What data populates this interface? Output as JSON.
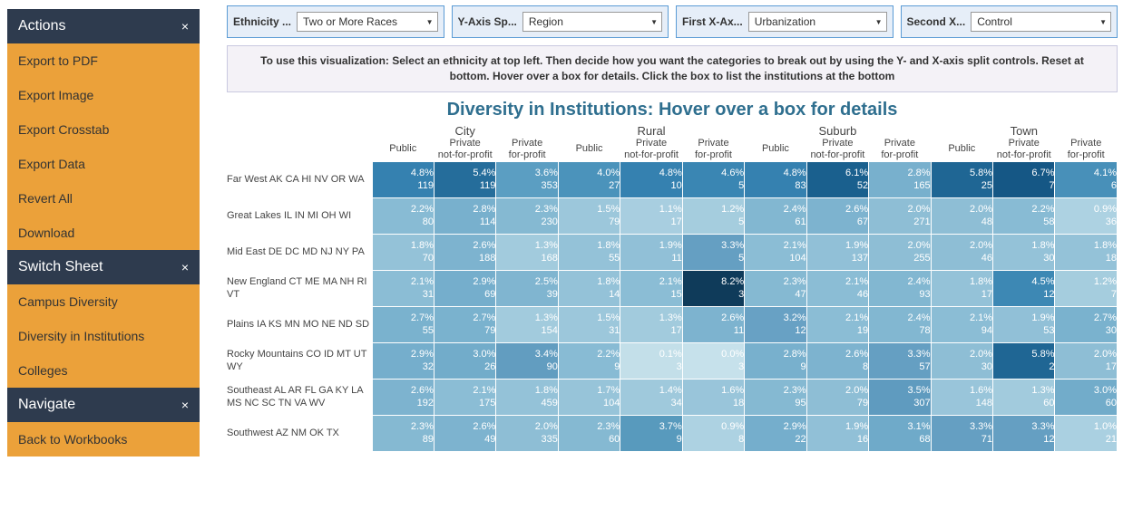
{
  "sidebar": {
    "sections": [
      {
        "title": "Actions",
        "close": "×",
        "items": [
          "Export to PDF",
          "Export Image",
          "Export Crosstab",
          "Export Data",
          "Revert All",
          "Download"
        ]
      },
      {
        "title": "Switch Sheet",
        "close": "×",
        "items": [
          "Campus Diversity",
          "Diversity in Institutions",
          "Colleges"
        ]
      },
      {
        "title": "Navigate",
        "close": "×",
        "items": [
          "Back to Workbooks"
        ]
      }
    ]
  },
  "controls": [
    {
      "label": "Ethnicity ...",
      "value": "Two or More Races"
    },
    {
      "label": "Y-Axis Sp...",
      "value": "Region"
    },
    {
      "label": "First X-Ax...",
      "value": "Urbanization"
    },
    {
      "label": "Second X...",
      "value": "Control"
    }
  ],
  "instructions": "To use this visualization: Select an ethnicity at top left.  Then decide how you want the categories to break out by using the Y- and X-axis split controls.  Reset at bottom.  Hover over a box for details.  Click the box to list the institutions at the bottom",
  "chart_title": "Diversity in Institutions: Hover over a box for details",
  "chart_data": {
    "type": "heatmap",
    "x_groups": [
      "City",
      "Rural",
      "Suburb",
      "Town"
    ],
    "x_sub": [
      "Public",
      "Private not-for-profit",
      "Private for-profit"
    ],
    "rows": [
      {
        "label": "Far West AK CA HI NV OR WA",
        "cells": [
          {
            "p": "4.8%",
            "c": "119",
            "bg": "#3581b0"
          },
          {
            "p": "5.4%",
            "c": "119",
            "bg": "#256d9b"
          },
          {
            "p": "3.6%",
            "c": "353",
            "bg": "#5b9ec2"
          },
          {
            "p": "4.0%",
            "c": "27",
            "bg": "#4b93bb"
          },
          {
            "p": "4.8%",
            "c": "10",
            "bg": "#3581b0"
          },
          {
            "p": "4.6%",
            "c": "5",
            "bg": "#3a86b3"
          },
          {
            "p": "4.8%",
            "c": "83",
            "bg": "#3581b0"
          },
          {
            "p": "6.1%",
            "c": "52",
            "bg": "#1a608e"
          },
          {
            "p": "2.8%",
            "c": "165",
            "bg": "#78b0cd"
          },
          {
            "p": "5.8%",
            "c": "25",
            "bg": "#1f6694"
          },
          {
            "p": "6.7%",
            "c": "7",
            "bg": "#155785"
          },
          {
            "p": "4.1%",
            "c": "6",
            "bg": "#4890b9"
          }
        ]
      },
      {
        "label": "Great Lakes IL IN MI OH WI",
        "cells": [
          {
            "p": "2.2%",
            "c": "80",
            "bg": "#88bbd4"
          },
          {
            "p": "2.8%",
            "c": "114",
            "bg": "#78b0cd"
          },
          {
            "p": "2.3%",
            "c": "230",
            "bg": "#85b9d2"
          },
          {
            "p": "1.5%",
            "c": "79",
            "bg": "#9cc7db"
          },
          {
            "p": "1.1%",
            "c": "17",
            "bg": "#a8cee0"
          },
          {
            "p": "1.2%",
            "c": "5",
            "bg": "#a5cdde"
          },
          {
            "p": "2.4%",
            "c": "61",
            "bg": "#82b7d1"
          },
          {
            "p": "2.6%",
            "c": "67",
            "bg": "#7db3cf"
          },
          {
            "p": "2.0%",
            "c": "271",
            "bg": "#8ebed5"
          },
          {
            "p": "2.0%",
            "c": "48",
            "bg": "#8ebed5"
          },
          {
            "p": "2.2%",
            "c": "58",
            "bg": "#88bbd4"
          },
          {
            "p": "0.9%",
            "c": "36",
            "bg": "#add2e2"
          }
        ]
      },
      {
        "label": "Mid East DE DC MD NJ NY PA",
        "cells": [
          {
            "p": "1.8%",
            "c": "70",
            "bg": "#94c2d8"
          },
          {
            "p": "2.6%",
            "c": "188",
            "bg": "#7db3cf"
          },
          {
            "p": "1.3%",
            "c": "168",
            "bg": "#a2cbdd"
          },
          {
            "p": "1.8%",
            "c": "55",
            "bg": "#94c2d8"
          },
          {
            "p": "1.9%",
            "c": "11",
            "bg": "#91c0d7"
          },
          {
            "p": "3.3%",
            "c": "5",
            "bg": "#659fc2"
          },
          {
            "p": "2.1%",
            "c": "104",
            "bg": "#8bbdd5"
          },
          {
            "p": "1.9%",
            "c": "137",
            "bg": "#91c0d7"
          },
          {
            "p": "2.0%",
            "c": "255",
            "bg": "#8ebed5"
          },
          {
            "p": "2.0%",
            "c": "46",
            "bg": "#8ebed5"
          },
          {
            "p": "1.8%",
            "c": "30",
            "bg": "#94c2d8"
          },
          {
            "p": "1.8%",
            "c": "18",
            "bg": "#94c2d8"
          }
        ]
      },
      {
        "label": "New England CT ME MA NH RI VT",
        "cells": [
          {
            "p": "2.1%",
            "c": "31",
            "bg": "#8bbdd5"
          },
          {
            "p": "2.9%",
            "c": "69",
            "bg": "#75aecc"
          },
          {
            "p": "2.5%",
            "c": "39",
            "bg": "#80b5d0"
          },
          {
            "p": "1.8%",
            "c": "14",
            "bg": "#94c2d8"
          },
          {
            "p": "2.1%",
            "c": "15",
            "bg": "#8bbdd5"
          },
          {
            "p": "8.2%",
            "c": "3",
            "bg": "#0f3b5a"
          },
          {
            "p": "2.3%",
            "c": "47",
            "bg": "#85b9d2"
          },
          {
            "p": "2.1%",
            "c": "46",
            "bg": "#8bbdd5"
          },
          {
            "p": "2.4%",
            "c": "93",
            "bg": "#82b7d1"
          },
          {
            "p": "1.8%",
            "c": "17",
            "bg": "#94c2d8"
          },
          {
            "p": "4.5%",
            "c": "12",
            "bg": "#3d88b4"
          },
          {
            "p": "1.2%",
            "c": "7",
            "bg": "#a5cdde"
          }
        ]
      },
      {
        "label": "Plains IA KS MN MO NE ND SD",
        "cells": [
          {
            "p": "2.7%",
            "c": "55",
            "bg": "#7ab2ce"
          },
          {
            "p": "2.7%",
            "c": "79",
            "bg": "#7ab2ce"
          },
          {
            "p": "1.3%",
            "c": "154",
            "bg": "#a2cbdd"
          },
          {
            "p": "1.5%",
            "c": "31",
            "bg": "#9cc7db"
          },
          {
            "p": "1.3%",
            "c": "17",
            "bg": "#a2cbdd"
          },
          {
            "p": "2.6%",
            "c": "11",
            "bg": "#7db3cf"
          },
          {
            "p": "3.2%",
            "c": "12",
            "bg": "#68a1c4"
          },
          {
            "p": "2.1%",
            "c": "19",
            "bg": "#8bbdd5"
          },
          {
            "p": "2.4%",
            "c": "78",
            "bg": "#82b7d1"
          },
          {
            "p": "2.1%",
            "c": "94",
            "bg": "#8bbdd5"
          },
          {
            "p": "1.9%",
            "c": "53",
            "bg": "#91c0d7"
          },
          {
            "p": "2.7%",
            "c": "30",
            "bg": "#7ab2ce"
          }
        ]
      },
      {
        "label": "Rocky Mountains CO ID MT UT WY",
        "cells": [
          {
            "p": "2.9%",
            "c": "32",
            "bg": "#75aecc"
          },
          {
            "p": "3.0%",
            "c": "26",
            "bg": "#72acca"
          },
          {
            "p": "3.4%",
            "c": "90",
            "bg": "#629dc0"
          },
          {
            "p": "2.2%",
            "c": "9",
            "bg": "#88bbd4"
          },
          {
            "p": "0.1%",
            "c": "3",
            "bg": "#c3dfe9"
          },
          {
            "p": "0.0%",
            "c": "3",
            "bg": "#c6e1eb"
          },
          {
            "p": "2.8%",
            "c": "9",
            "bg": "#78b0cd"
          },
          {
            "p": "2.6%",
            "c": "8",
            "bg": "#7db3cf"
          },
          {
            "p": "3.3%",
            "c": "57",
            "bg": "#659fc2"
          },
          {
            "p": "2.0%",
            "c": "30",
            "bg": "#8ebed5"
          },
          {
            "p": "5.8%",
            "c": "2",
            "bg": "#1f6694"
          },
          {
            "p": "2.0%",
            "c": "17",
            "bg": "#8ebed5"
          }
        ]
      },
      {
        "label": "Southeast AL AR FL GA KY LA MS NC SC TN VA WV",
        "cells": [
          {
            "p": "2.6%",
            "c": "192",
            "bg": "#7db3cf"
          },
          {
            "p": "2.1%",
            "c": "175",
            "bg": "#8bbdd5"
          },
          {
            "p": "1.8%",
            "c": "459",
            "bg": "#94c2d8"
          },
          {
            "p": "1.7%",
            "c": "104",
            "bg": "#97c4d9"
          },
          {
            "p": "1.4%",
            "c": "34",
            "bg": "#9fc9dc"
          },
          {
            "p": "1.6%",
            "c": "18",
            "bg": "#99c5da"
          },
          {
            "p": "2.3%",
            "c": "95",
            "bg": "#85b9d2"
          },
          {
            "p": "2.0%",
            "c": "79",
            "bg": "#8ebed5"
          },
          {
            "p": "3.5%",
            "c": "307",
            "bg": "#5f9bbf"
          },
          {
            "p": "1.6%",
            "c": "148",
            "bg": "#99c5da"
          },
          {
            "p": "1.3%",
            "c": "60",
            "bg": "#a2cbdd"
          },
          {
            "p": "3.0%",
            "c": "60",
            "bg": "#72acca"
          }
        ]
      },
      {
        "label": "Southwest AZ NM OK TX",
        "cells": [
          {
            "p": "2.3%",
            "c": "89",
            "bg": "#85b9d2"
          },
          {
            "p": "2.6%",
            "c": "49",
            "bg": "#7db3cf"
          },
          {
            "p": "2.0%",
            "c": "335",
            "bg": "#8ebed5"
          },
          {
            "p": "2.3%",
            "c": "60",
            "bg": "#85b9d2"
          },
          {
            "p": "3.7%",
            "c": "9",
            "bg": "#589abd"
          },
          {
            "p": "0.9%",
            "c": "8",
            "bg": "#add2e2"
          },
          {
            "p": "2.9%",
            "c": "22",
            "bg": "#75aecc"
          },
          {
            "p": "1.9%",
            "c": "16",
            "bg": "#91c0d7"
          },
          {
            "p": "3.1%",
            "c": "68",
            "bg": "#6faac9"
          },
          {
            "p": "3.3%",
            "c": "71",
            "bg": "#659fc2"
          },
          {
            "p": "3.3%",
            "c": "12",
            "bg": "#659fc2"
          },
          {
            "p": "1.0%",
            "c": "21",
            "bg": "#aad0e1"
          }
        ]
      }
    ]
  }
}
